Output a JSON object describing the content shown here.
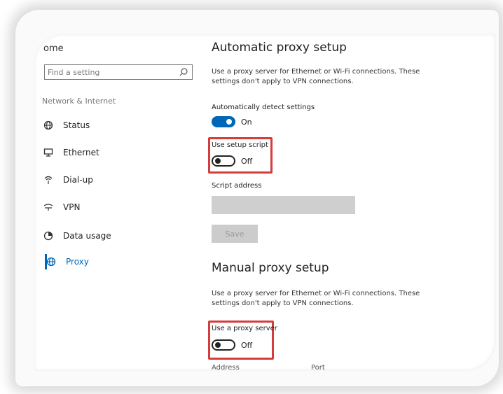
{
  "sidebar": {
    "home_label": "ome",
    "search": {
      "placeholder": "Find a setting"
    },
    "section_title": "Network & Internet",
    "items": [
      {
        "label": "Status",
        "icon": "globe-icon"
      },
      {
        "label": "Ethernet",
        "icon": "monitor-icon"
      },
      {
        "label": "Dial-up",
        "icon": "phone-icon"
      },
      {
        "label": "VPN",
        "icon": "vpn-icon"
      },
      {
        "label": "Data usage",
        "icon": "data-usage-icon"
      },
      {
        "label": "Proxy",
        "icon": "globe-icon",
        "active": true
      }
    ]
  },
  "auto": {
    "title": "Automatic proxy setup",
    "description": "Use a proxy server for Ethernet or Wi-Fi connections. These settings don't apply to VPN connections.",
    "detect_label": "Automatically detect settings",
    "detect_state": "On",
    "script_label": "Use setup script",
    "script_state": "Off",
    "address_label": "Script address",
    "address_value": "",
    "save_label": "Save"
  },
  "manual": {
    "title": "Manual proxy setup",
    "description": "Use a proxy server for Ethernet or Wi-Fi connections. These settings don't apply to VPN connections.",
    "proxy_label": "Use a proxy server",
    "proxy_state": "Off",
    "address_label": "Address",
    "port_label": "Port"
  },
  "colors": {
    "accent": "#0067b8",
    "highlight": "#d73c3c"
  }
}
